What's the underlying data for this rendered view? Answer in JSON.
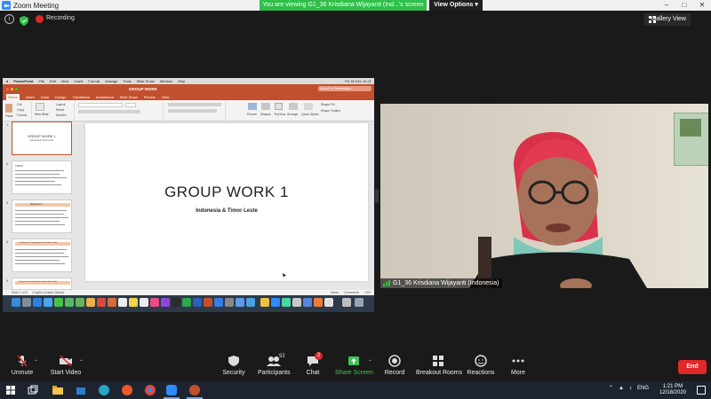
{
  "window": {
    "title": "Zoom Meeting"
  },
  "share_banner": {
    "text": "You are viewing G1_36 Krisdiana Wijayanti (Ind...'s screen",
    "view_options": "View Options"
  },
  "top": {
    "recording_label": "Recording",
    "gallery_view": "Gallery View"
  },
  "shared_screen": {
    "mac_menu": {
      "app": "PowerPoint",
      "items": [
        "File",
        "Edit",
        "View",
        "Insert",
        "Format",
        "Arrange",
        "Tools",
        "Slide Show",
        "Window",
        "Help"
      ],
      "datetime": "Fri 18 Dec 13.21"
    },
    "document_title": "GROUP WORK",
    "search_placeholder": "Search in Presentation",
    "ribbon_tabs": [
      "Home",
      "Insert",
      "Draw",
      "Design",
      "Transitions",
      "Animations",
      "Slide Show",
      "Review",
      "View"
    ],
    "ribbon": {
      "paste": "Paste",
      "cut": "Cut",
      "copy": "Copy",
      "format": "Format",
      "new_slide": "New Slide",
      "layout": "Layout",
      "reset": "Reset",
      "section": "Section",
      "picture": "Picture",
      "shapes": "Shapes",
      "text_box": "Text Box",
      "arrange": "Arrange",
      "quick_styles": "Quick Styles",
      "shape_fill": "Shape Fill",
      "shape_outline": "Shape Outline"
    },
    "thumbnails": [
      {
        "num": "1",
        "title": "GROUP WORK 1",
        "subtitle": "Indonesia & Timor Leste"
      },
      {
        "num": "2",
        "title": "TOPIC"
      },
      {
        "num": "3",
        "title": "Background"
      },
      {
        "num": "4",
        "title": "Expectation & Challenges and Possible Trouble"
      },
      {
        "num": "5",
        "title": "Expectation & Challenges and Possible Trouble"
      }
    ],
    "slide": {
      "title": "GROUP WORK 1",
      "subtitle": "Indonesia & Timor Leste"
    },
    "status": {
      "slide": "Slide 1 of 8",
      "language": "English (United States)",
      "notes": "Notes",
      "comments": "Comments",
      "zoom": "70%"
    }
  },
  "speaker": {
    "name": "G1_36 Krisdiana Wijayanti (Indonesia)"
  },
  "toolbar": {
    "unmute": "Unmute",
    "start_video": "Start Video",
    "security": "Security",
    "participants": "Participants",
    "participants_count": "92",
    "chat": "Chat",
    "chat_badge": "2",
    "share_screen": "Share Screen",
    "record": "Record",
    "breakout_rooms": "Breakout Rooms",
    "reactions": "Reactions",
    "more": "More",
    "end": "End"
  },
  "taskbar": {
    "time": "1:21 PM",
    "date": "12/18/2020",
    "lang": "ENG"
  },
  "colors": {
    "zoom_blue": "#2d8cff",
    "banner_green": "#2fbf4a",
    "end_red": "#e02828",
    "ppt_orange": "#c2502c"
  }
}
